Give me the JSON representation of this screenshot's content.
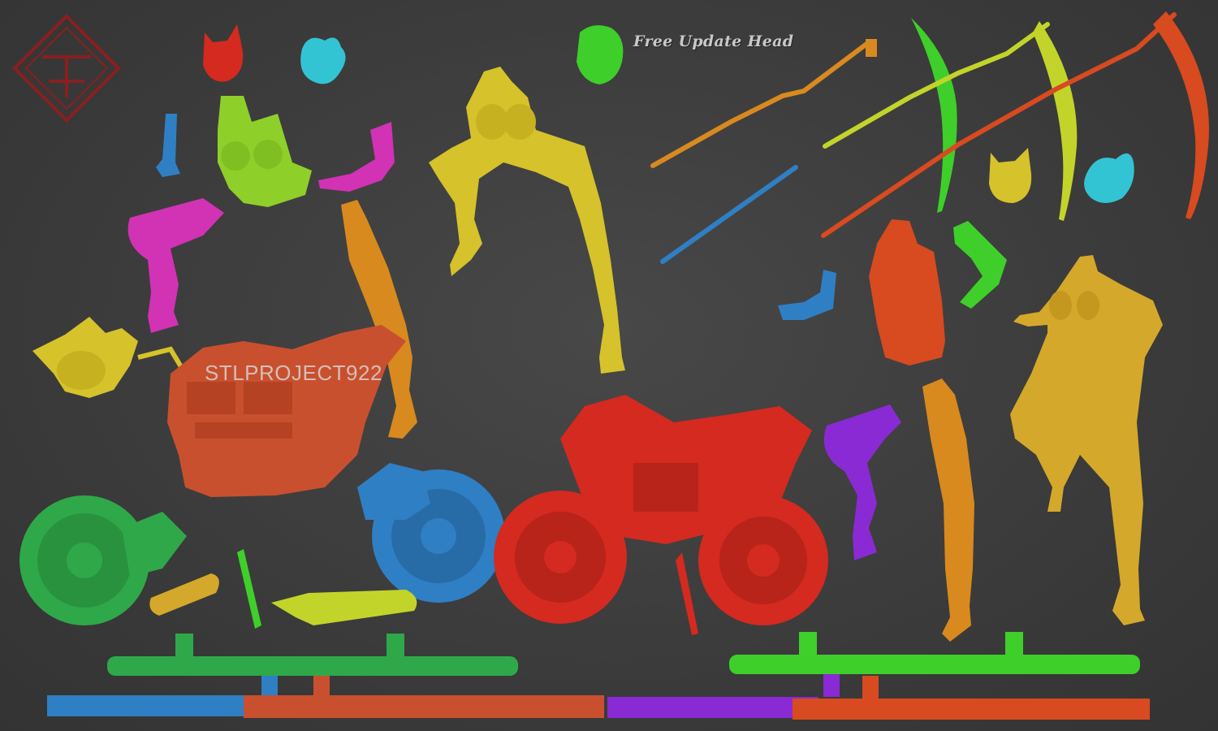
{
  "labels": {
    "free_update": "Free Update Head",
    "watermark": "STLPROJECT922"
  },
  "colors": {
    "background": "#3a3a3a",
    "logo": "#8a1f1f",
    "red": "#d42a1f",
    "orange_red": "#c9502e",
    "green": "#2fa84a",
    "bright_green": "#3fcf2a",
    "blue": "#2f7fc4",
    "cyan": "#33c4d4",
    "magenta": "#d232b4",
    "purple": "#8a2ad4",
    "yellow": "#d6c22a",
    "gold": "#d4a82a",
    "orange": "#d88a1e",
    "lime": "#c2d42a"
  },
  "icons": [
    "studio-logo-icon"
  ]
}
